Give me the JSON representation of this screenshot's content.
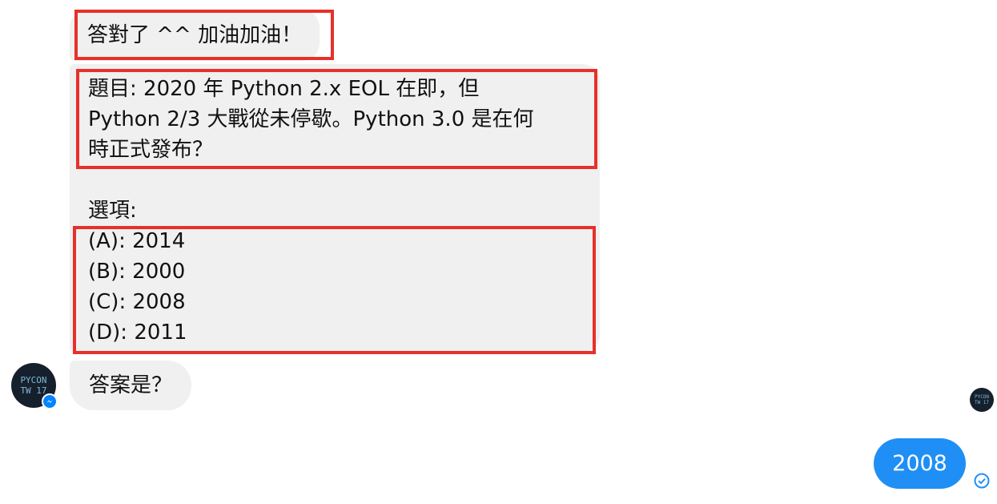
{
  "messages": {
    "cheer": "答對了 ^^ 加油加油！",
    "question": {
      "line1": "題目: 2020 年 Python 2.x EOL 在即，但",
      "line2": "Python 2/3 大戰從未停歇。Python 3.0 是在何",
      "line3": "時正式發布？",
      "options_label": "選項:",
      "options": [
        "(A): 2014",
        "(B): 2000",
        "(C): 2008",
        "(D): 2011"
      ]
    },
    "prompt": "答案是？",
    "reply": "2008"
  },
  "avatar": {
    "line1": "PYCON",
    "line2": "TW 17"
  },
  "icons": {
    "messenger_badge": "messenger-icon",
    "read_receipt": "check-circle-icon"
  },
  "colors": {
    "incoming_bubble": "#f0f0f0",
    "outgoing_bubble": "#1f8ff5",
    "highlight": "#e7302a"
  }
}
